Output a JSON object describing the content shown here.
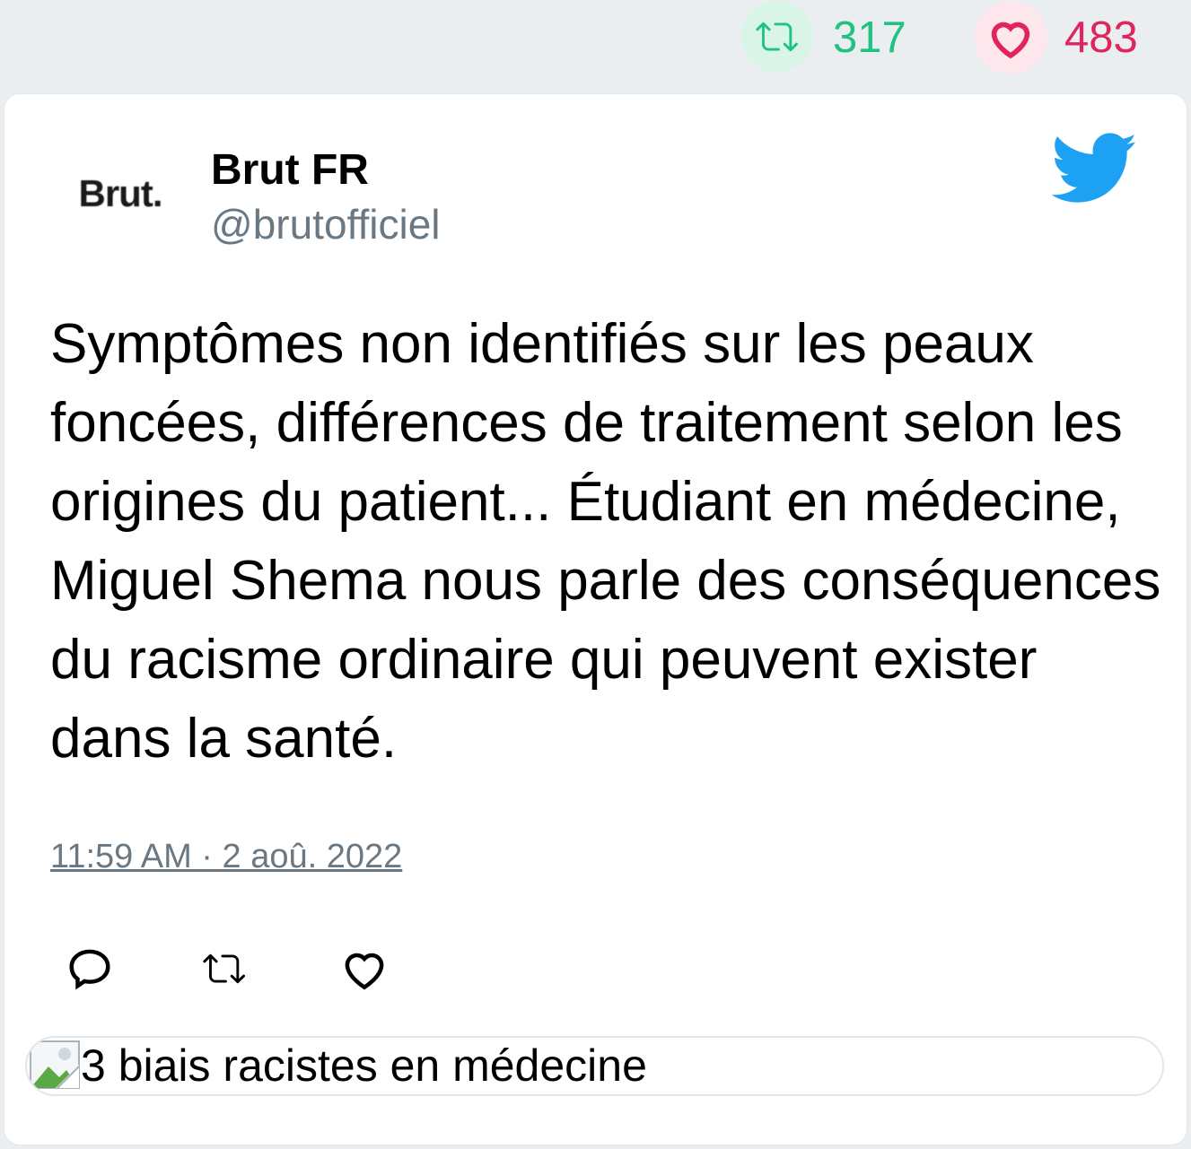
{
  "stats": {
    "retweet_count": "317",
    "like_count": "483",
    "retweet_color": "#1fc37f",
    "like_color": "#e0245e",
    "retweet_icon": "retweet-icon",
    "like_icon": "heart-icon"
  },
  "tweet": {
    "author_name": "Brut FR",
    "author_handle": "@brutofficiel",
    "avatar_text": "Brut.",
    "brand_icon": "twitter-bird-icon",
    "brand_color": "#1da1f2",
    "text": "Symptômes non identifiés sur les peaux foncées, différences de traitement selon les origines du patient... Étudiant en médecine, Miguel Shema nous parle des conséquences du racisme ordinaire qui peuvent exister dans la santé.",
    "timestamp": "11:59 AM · 2 aoû. 2022"
  },
  "actions": {
    "reply_icon": "reply-icon",
    "retweet_icon": "retweet-icon",
    "like_icon": "heart-icon"
  },
  "link_card": {
    "title": "3 biais racistes en médecine",
    "image_icon": "broken-image-icon"
  }
}
